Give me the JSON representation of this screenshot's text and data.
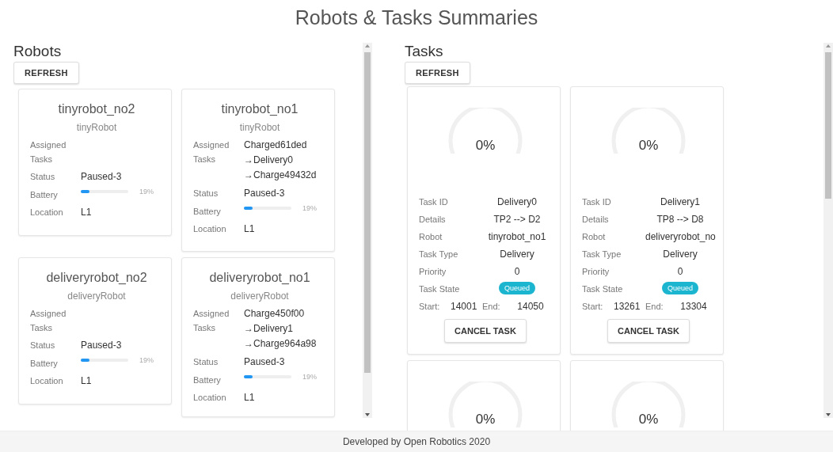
{
  "title": "Robots & Tasks Summaries",
  "robots": {
    "heading": "Robots",
    "refresh": "REFRESH",
    "items": [
      {
        "name": "tinyrobot_no2",
        "model": "tinyRobot",
        "fields": [
          {
            "kind": "list",
            "label": [
              "Assigned",
              "Tasks"
            ]
          },
          {
            "kind": "text",
            "label": "Status",
            "value": "Paused-3"
          },
          {
            "kind": "battery",
            "label": "Battery",
            "level": 0.19,
            "reading": "19%"
          },
          {
            "kind": "text",
            "label": "Location",
            "value": "L1"
          }
        ]
      },
      {
        "name": "tinyrobot_no1",
        "model": "tinyRobot",
        "fields": [
          {
            "kind": "list",
            "label": [
              "Assigned",
              "Tasks"
            ],
            "values": [
              "Charged61ded",
              "→Delivery0",
              "→Charge49432d"
            ]
          },
          {
            "kind": "text",
            "label": "Status",
            "value": "Paused-3"
          },
          {
            "kind": "battery",
            "label": "Battery",
            "level": 0.19,
            "reading": "19%"
          },
          {
            "kind": "text",
            "label": "Location",
            "value": "L1"
          }
        ]
      },
      {
        "name": "deliveryrobot_no2",
        "model": "deliveryRobot",
        "fields": [
          {
            "kind": "list",
            "label": [
              "Assigned",
              "Tasks"
            ]
          },
          {
            "kind": "text",
            "label": "Status",
            "value": "Paused-3"
          },
          {
            "kind": "battery",
            "label": "Battery",
            "level": 0.19,
            "reading": "19%"
          },
          {
            "kind": "text",
            "label": "Location",
            "value": "L1"
          }
        ]
      },
      {
        "name": "deliveryrobot_no1",
        "model": "deliveryRobot",
        "fields": [
          {
            "kind": "list",
            "label": [
              "Assigned",
              "Tasks"
            ],
            "values": [
              "Charge450f00",
              "→Delivery1",
              "→Charge964a98"
            ]
          },
          {
            "kind": "text",
            "label": "Status",
            "value": "Paused-3"
          },
          {
            "kind": "battery",
            "label": "Battery",
            "level": 0.19,
            "reading": "19%"
          },
          {
            "kind": "text",
            "label": "Location",
            "value": "L1"
          }
        ]
      }
    ]
  },
  "tasks": {
    "heading": "Tasks",
    "refresh": "REFRESH",
    "items": [
      {
        "progress": "0%",
        "fields": [
          {
            "kind": "text",
            "label": "Task ID",
            "value": "Delivery0"
          },
          {
            "kind": "text",
            "label": "Details",
            "value": "TP2 --> D2"
          },
          {
            "kind": "text",
            "label": "Robot",
            "value": "tinyrobot_no1"
          },
          {
            "kind": "text",
            "label": "Task Type",
            "value": "Delivery"
          },
          {
            "kind": "text",
            "label": "Priority",
            "value": "0"
          },
          {
            "kind": "badge",
            "label": "Task State",
            "value": "Queued"
          }
        ],
        "start_label": "Start:",
        "start": "14001",
        "end_label": "End:",
        "end": "14050",
        "cancel": "CANCEL TASK"
      },
      {
        "progress": "0%",
        "fields": [
          {
            "kind": "text",
            "label": "Task ID",
            "value": "Delivery1"
          },
          {
            "kind": "text",
            "label": "Details",
            "value": "TP8 --> D8"
          },
          {
            "kind": "text",
            "label": "Robot",
            "value": "deliveryrobot_no"
          },
          {
            "kind": "text",
            "label": "Task Type",
            "value": "Delivery"
          },
          {
            "kind": "text",
            "label": "Priority",
            "value": "0"
          },
          {
            "kind": "badge",
            "label": "Task State",
            "value": "Queued"
          }
        ],
        "start_label": "Start:",
        "start": "13261",
        "end_label": "End:",
        "end": "13304",
        "cancel": "CANCEL TASK"
      },
      {
        "progress": "0%"
      },
      {
        "progress": "0%"
      }
    ]
  },
  "footer": "Developed by Open Robotics 2020"
}
